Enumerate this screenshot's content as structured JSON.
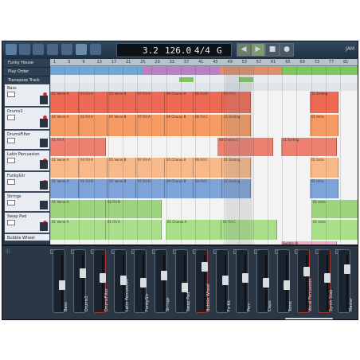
{
  "toolbar": {
    "position": "3.2",
    "tempo": "126.0",
    "signature": "4/4",
    "key": "G",
    "logo": "JAM"
  },
  "ruler": [
    "1",
    "5",
    "9",
    "13",
    "17",
    "21",
    "25",
    "29",
    "33",
    "37",
    "41",
    "45",
    "49",
    "53",
    "57",
    "61",
    "65",
    "69",
    "73",
    "77",
    "81"
  ],
  "global_tracks": [
    "Funky House",
    "Play Order",
    "Transpose Track"
  ],
  "tracks": [
    {
      "name": "Bass",
      "color": "#ef6a55",
      "clips": [
        "01 Verse A",
        "03 Fill A",
        "05 Verse B",
        "07 Fill A",
        "09 Chorus A",
        "06 Fill B",
        "03 Fill C",
        "11 Ending"
      ]
    },
    {
      "name": "Drums1",
      "color": "#f59a62",
      "clips": [
        "02 Verse A",
        "02 Fill A",
        "05 Verse B",
        "07 Fill A",
        "09 Chorus B",
        "06 Fill C",
        "11 Ending",
        "01 Intro"
      ]
    },
    {
      "name": "DrumsFilter",
      "color": "#ee8070",
      "clips": [
        "01 Fill A",
        "06 Chorus C",
        "11 Ending"
      ]
    },
    {
      "name": "Latin Percussion",
      "color": "#f7b98a",
      "clips": [
        "01 Verse A",
        "04 Fill A",
        "05 Verse B",
        "07 Fill A",
        "05 Chorus A",
        "06 Fill C",
        "01 Ending",
        "01 Intro"
      ]
    },
    {
      "name": "FunkyGtr",
      "color": "#7ea3d8",
      "clips": [
        "01 Verse A",
        "02 Fill B",
        "05 Verse B",
        "07 Fill B",
        "09 Chorus B",
        "04 Fill C",
        "11 Ending",
        "01 Intro"
      ]
    },
    {
      "name": "Strings",
      "color": "#9bd47c",
      "clips": [
        "01 Verse A",
        "02 Fill B",
        "01 Intro"
      ]
    },
    {
      "name": "Swap Pad",
      "color": "#a9de8a",
      "clips": [
        "01 Verse A",
        "01 Fill A",
        "01 Chorus A",
        "01 Fill C",
        "01 Intro"
      ]
    },
    {
      "name": "Bubble Wheel",
      "color": "#e9b0c8",
      "clips": [
        "Bubble W"
      ]
    }
  ],
  "mixer": [
    "Bass",
    "Drums1",
    "DrumsFilter",
    "Latin Percussion",
    "FunkyGtr",
    "Strings",
    "Swap Pad",
    "Bubble Wheel",
    "Fx Kit",
    "Perc",
    "Claps",
    "Toms",
    "Vocal Percussion",
    "Synth Stab",
    "Master"
  ],
  "mixer_levels": [
    0.45,
    0.7,
    0.6,
    0.55,
    0.5,
    0.65,
    0.4,
    0.85,
    0.55,
    0.6,
    0.5,
    0.45,
    0.75,
    0.6,
    0.8
  ],
  "colors": {
    "accent": "#7fc85e",
    "record": "#c33333"
  }
}
